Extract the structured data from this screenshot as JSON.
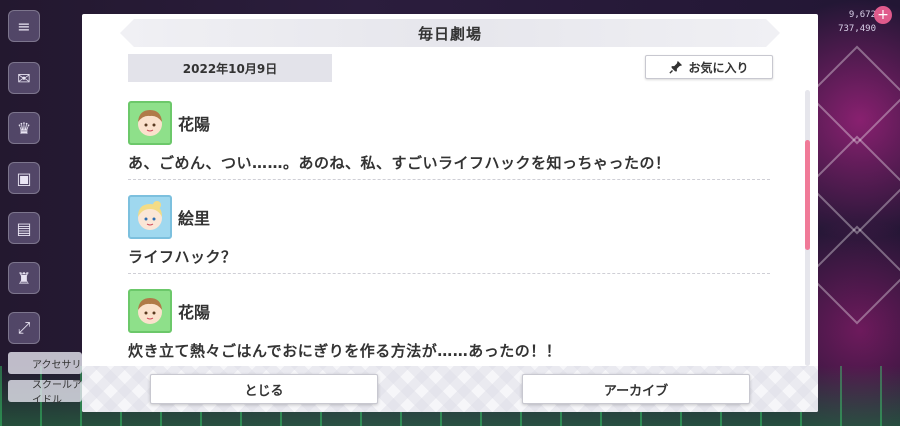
{
  "dialog": {
    "title": "毎日劇場",
    "date": "2022年10月9日",
    "favorite_label": "お気に入り",
    "close_label": "とじる",
    "archive_label": "アーカイブ"
  },
  "entries": [
    {
      "speaker": "花陽",
      "text": "あ、ごめん、つい……。あのね、私、すごいライフハックを知っちゃったの！",
      "avatar_icon": "hanayo-avatar-icon"
    },
    {
      "speaker": "絵里",
      "text": "ライフハック？",
      "avatar_icon": "eli-avatar-icon"
    },
    {
      "speaker": "花陽",
      "text": "炊き立て熱々ごはんでおにぎりを作る方法が……あったの！！",
      "avatar_icon": "hanayo-avatar-icon"
    }
  ],
  "background": {
    "stat_top": "9,672",
    "stat_bottom": "737,490",
    "rail_tag_1": "アクセサリ",
    "rail_tag_2": "スクールアイドル"
  },
  "colors": {
    "accent": "#f07a98",
    "panel": "#ffffff",
    "title_bar": "#e6e6ec",
    "text": "#333333"
  }
}
